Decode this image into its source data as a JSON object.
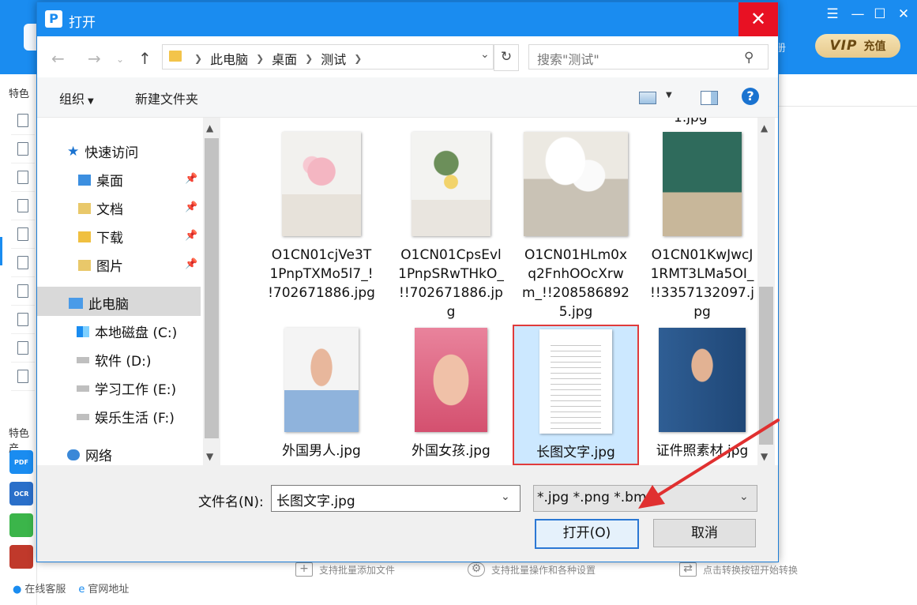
{
  "app": {
    "sidebar_fragment_top": "特色",
    "sidebar_fragment_mid": "特色产",
    "topbar_fragment": "册",
    "vip_label": "VIP",
    "vip_action": "充值",
    "links": [
      {
        "icon": "headset-icon",
        "label": "在线客服"
      },
      {
        "icon": "ie-icon",
        "label": "官网地址"
      }
    ],
    "hints": [
      {
        "icon": "plus-icon",
        "label": "支持批量添加文件"
      },
      {
        "icon": "gear-icon",
        "label": "支持批量操作和各种设置"
      },
      {
        "icon": "convert-icon",
        "label": "点击转换按钮开始转换"
      }
    ],
    "tool_badges": [
      "PDF",
      "OCR"
    ]
  },
  "dialog": {
    "title": "打开",
    "address_crumbs": [
      "此电脑",
      "桌面",
      "测试"
    ],
    "search_placeholder": "搜索\"测试\"",
    "toolbar": {
      "organize": "组织",
      "new_folder": "新建文件夹"
    },
    "nav": {
      "quick_access": "快速访问",
      "pinned": [
        "桌面",
        "文档",
        "下载",
        "图片"
      ],
      "this_pc": "此电脑",
      "drives": [
        "本地磁盘 (C:)",
        "软件 (D:)",
        "学习工作 (E:)",
        "娱乐生活 (F:)"
      ],
      "network": "网络"
    },
    "top_cut_label": "1.jpg",
    "files": [
      {
        "name": "O1CN01cjVe3T1PnpTXMo5l7_!!702671886.jpg",
        "lines": [
          "O1CN01cjVe3T",
          "1PnpTXMo5l7_!",
          "!702671886.jpg"
        ],
        "kind": "flowers-pink",
        "selected": false
      },
      {
        "name": "O1CN01CpsEvl1PnpSRwTHkO_!!702671886.jpg",
        "lines": [
          "O1CN01CpsEvl",
          "1PnpSRwTHkO_",
          "!!702671886.jp",
          "g"
        ],
        "kind": "flowers-yellow",
        "selected": false
      },
      {
        "name": "O1CN01HLm0xq2FnhOOcXrwm_!!2085868925.jpg",
        "lines": [
          "O1CN01HLm0x",
          "q2FnhOOcXrw",
          "m_!!208586892",
          "5.jpg"
        ],
        "kind": "tables",
        "selected": false
      },
      {
        "name": "O1CN01KwJwcJ1RMT3LMa5OI_!!3357132097.jpg",
        "lines": [
          "O1CN01KwJwcJ",
          "1RMT3LMa5OI_",
          "!!3357132097.j",
          "pg"
        ],
        "kind": "side-table",
        "selected": false
      },
      {
        "name": "外国男人.jpg",
        "lines": [
          "外国男人.jpg"
        ],
        "kind": "man",
        "selected": false
      },
      {
        "name": "外国女孩.jpg",
        "lines": [
          "外国女孩.jpg"
        ],
        "kind": "girl",
        "selected": false
      },
      {
        "name": "长图文字.jpg",
        "lines": [
          "长图文字.jpg"
        ],
        "kind": "text-doc",
        "selected": true
      },
      {
        "name": "证件照素材.jpg",
        "lines": [
          "证件照素材.jpg"
        ],
        "kind": "suit",
        "selected": false
      }
    ],
    "filename_label": "文件名(N):",
    "filename_value": "长图文字.jpg",
    "filetype_value": "*.jpg *.png *.bmp",
    "open_button": "打开(O)",
    "cancel_button": "取消"
  },
  "colors": {
    "accent": "#1a8cf0",
    "close_red": "#e81123",
    "selection_border": "#e03b3b",
    "selection_fill": "#cce8ff",
    "annotation_arrow": "#e03030"
  }
}
